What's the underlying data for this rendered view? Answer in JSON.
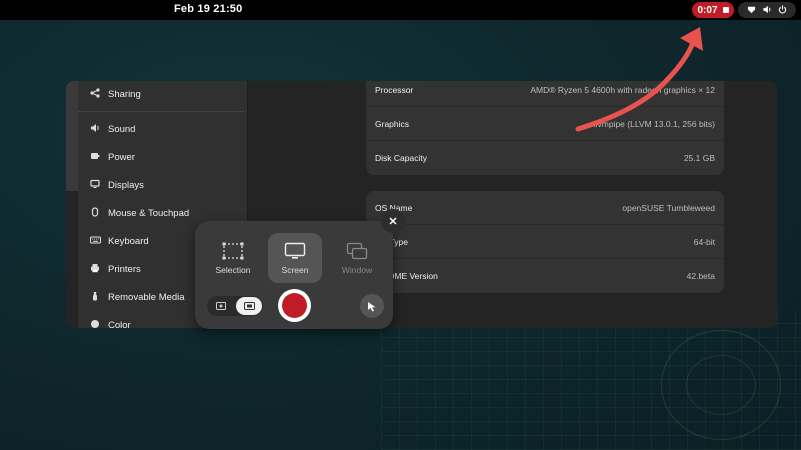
{
  "topbar": {
    "clock": "Feb 19  21:50",
    "recording_time": "0:07",
    "recording_color": "#c01c28",
    "status_icons": [
      "network-icon",
      "volume-icon",
      "power-icon"
    ]
  },
  "sidebar": {
    "items": [
      {
        "label": "Sharing",
        "icon": "share-icon"
      },
      {
        "label": "Sound",
        "icon": "speaker-icon"
      },
      {
        "label": "Power",
        "icon": "battery-icon"
      },
      {
        "label": "Displays",
        "icon": "display-icon"
      },
      {
        "label": "Mouse & Touchpad",
        "icon": "mouse-icon"
      },
      {
        "label": "Keyboard",
        "icon": "keyboard-icon"
      },
      {
        "label": "Printers",
        "icon": "printer-icon"
      },
      {
        "label": "Removable Media",
        "icon": "usb-icon"
      },
      {
        "label": "Color",
        "icon": "color-icon"
      }
    ]
  },
  "hardware": {
    "rows": [
      {
        "label": "Processor",
        "value": "AMD® Ryzen 5 4600h with radeon graphics × 12"
      },
      {
        "label": "Graphics",
        "value": "llvmpipe (LLVM 13.0.1, 256 bits)"
      },
      {
        "label": "Disk Capacity",
        "value": "25.1 GB"
      }
    ]
  },
  "software": {
    "rows": [
      {
        "label": "OS Name",
        "value": "openSUSE Tumbleweed"
      },
      {
        "label": "OS Type",
        "value": "64-bit"
      },
      {
        "label": "GNOME Version",
        "value": "42.beta"
      }
    ]
  },
  "screenshot_ui": {
    "modes": [
      {
        "label": "Selection",
        "icon": "selection-icon"
      },
      {
        "label": "Screen",
        "icon": "monitor-icon"
      },
      {
        "label": "Window",
        "icon": "window-icon"
      }
    ],
    "selected_mode": "Screen",
    "capture_toggle": [
      "screenshot-icon",
      "screencast-icon"
    ],
    "record_color": "#c01c28"
  },
  "annotation": {
    "arrow_color": "#e8534f"
  }
}
